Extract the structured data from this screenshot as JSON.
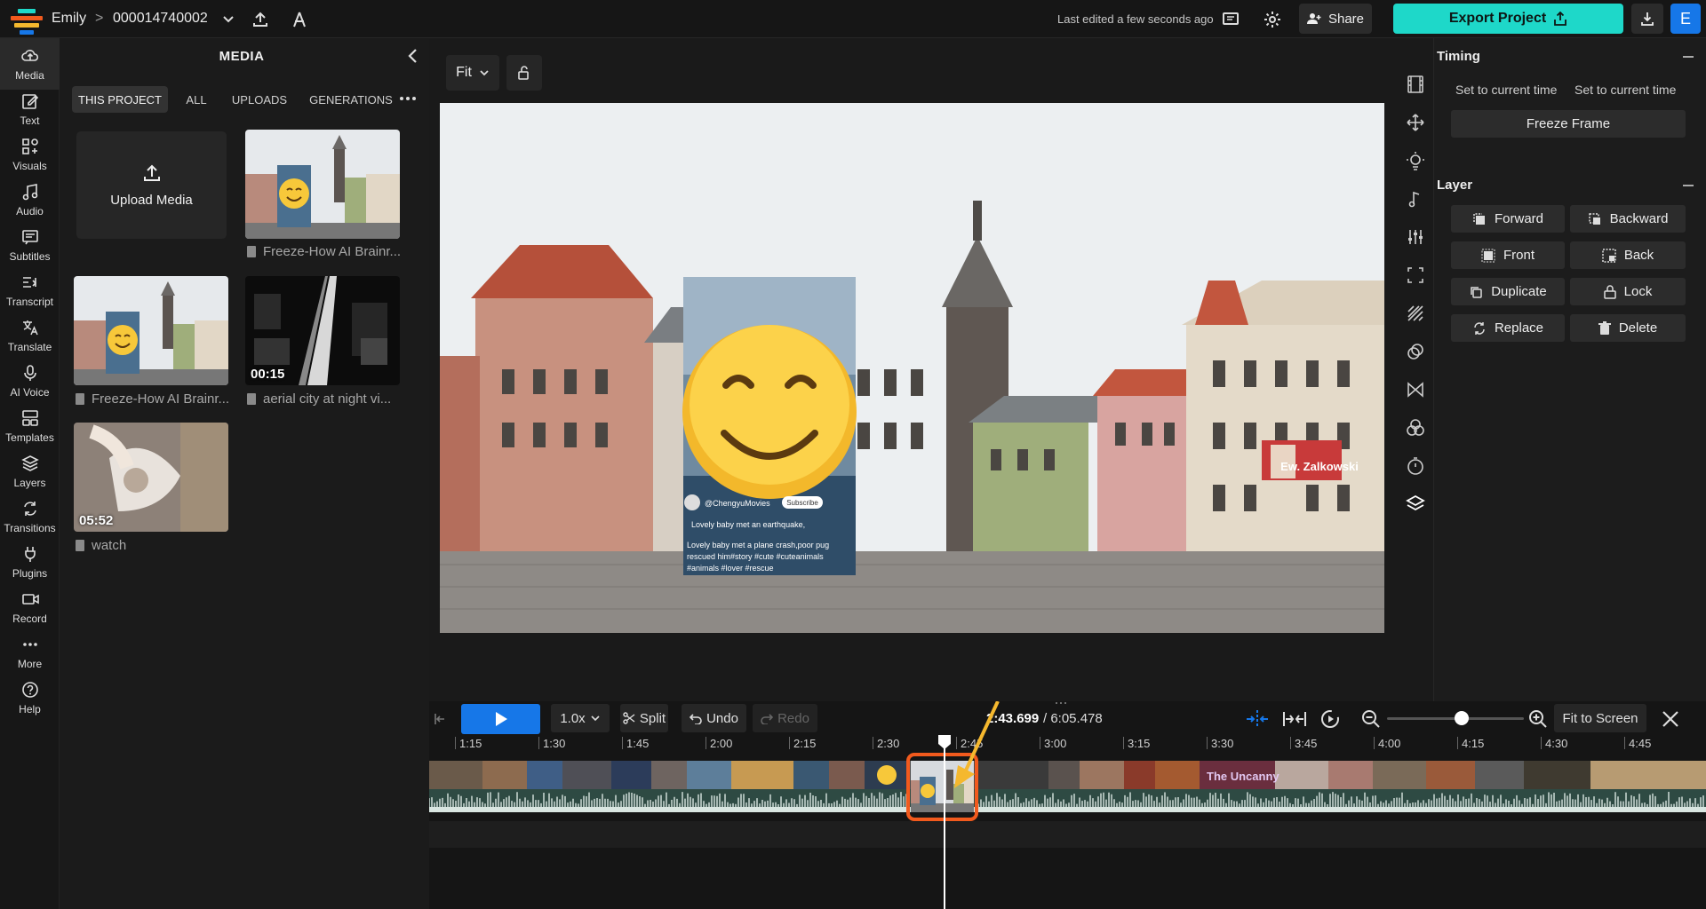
{
  "topbar": {
    "user": "Emily",
    "separator": ">",
    "project_name": "000014740002",
    "last_edited": "Last edited a few seconds ago",
    "share_label": "Share",
    "export_label": "Export Project",
    "avatar_initial": "E"
  },
  "leftnav": {
    "items": [
      {
        "label": "Media",
        "icon": "cloud-upload-icon",
        "active": true
      },
      {
        "label": "Text",
        "icon": "edit-icon"
      },
      {
        "label": "Visuals",
        "icon": "shapes-icon"
      },
      {
        "label": "Audio",
        "icon": "music-note-icon"
      },
      {
        "label": "Subtitles",
        "icon": "subtitles-icon"
      },
      {
        "label": "Transcript",
        "icon": "transcript-icon"
      },
      {
        "label": "Translate",
        "icon": "translate-icon"
      },
      {
        "label": "AI Voice",
        "icon": "microphone-icon"
      },
      {
        "label": "Templates",
        "icon": "templates-icon"
      },
      {
        "label": "Layers",
        "icon": "layers-icon"
      },
      {
        "label": "Transitions",
        "icon": "transitions-icon"
      },
      {
        "label": "Plugins",
        "icon": "plug-icon"
      },
      {
        "label": "Record",
        "icon": "camera-icon"
      },
      {
        "label": "More",
        "icon": "dots-icon"
      },
      {
        "label": "Help",
        "icon": "help-icon"
      }
    ]
  },
  "media": {
    "title": "MEDIA",
    "tabs": [
      "THIS PROJECT",
      "ALL",
      "UPLOADS",
      "GENERATIONS"
    ],
    "upload_label": "Upload Media",
    "items": [
      {
        "label": "Freeze-How AI Brainr...",
        "duration": ""
      },
      {
        "label": "Freeze-How AI Brainr...",
        "duration": ""
      },
      {
        "label": "aerial city at night vi...",
        "duration": "00:15"
      },
      {
        "label": "watch",
        "duration": "05:52"
      }
    ]
  },
  "canvas": {
    "fit_label": "Fit",
    "overlay": {
      "handle": "@ChengyuMovies",
      "subscribe": "Subscribe",
      "line1": "Lovely baby met an earthquake,",
      "caption": "Lovely baby met a plane crash,poor pug rescued him#story #cute #cuteanimals #animals #lover #rescue"
    },
    "poster_text": "Ew. Zalkowski"
  },
  "props": {
    "timing_title": "Timing",
    "set_current_1": "Set to current time",
    "set_current_2": "Set to current time",
    "freeze_frame": "Freeze Frame",
    "layer_title": "Layer",
    "layer_buttons": [
      "Forward",
      "Backward",
      "Front",
      "Back",
      "Duplicate",
      "Lock",
      "Replace",
      "Delete"
    ]
  },
  "timeline": {
    "speed": "1.0x",
    "split": "Split",
    "undo": "Undo",
    "redo": "Redo",
    "current_time": "2:43.699",
    "total_time": "/ 6:05.478",
    "fit_to_screen": "Fit to Screen",
    "zoom_level": 0.55,
    "ticks": [
      "1:15",
      "1:30",
      "1:45",
      "2:00",
      "2:15",
      "2:30",
      "2:45",
      "3:00",
      "3:15",
      "3:30",
      "3:45",
      "4:00",
      "4:15",
      "4:30",
      "4:45"
    ],
    "clip_text": "The Uncanny"
  },
  "colors": {
    "accent": "#1ed8c9",
    "primary": "#1677e8",
    "highlight": "#f25a1d",
    "arrow": "#f5b82e"
  }
}
